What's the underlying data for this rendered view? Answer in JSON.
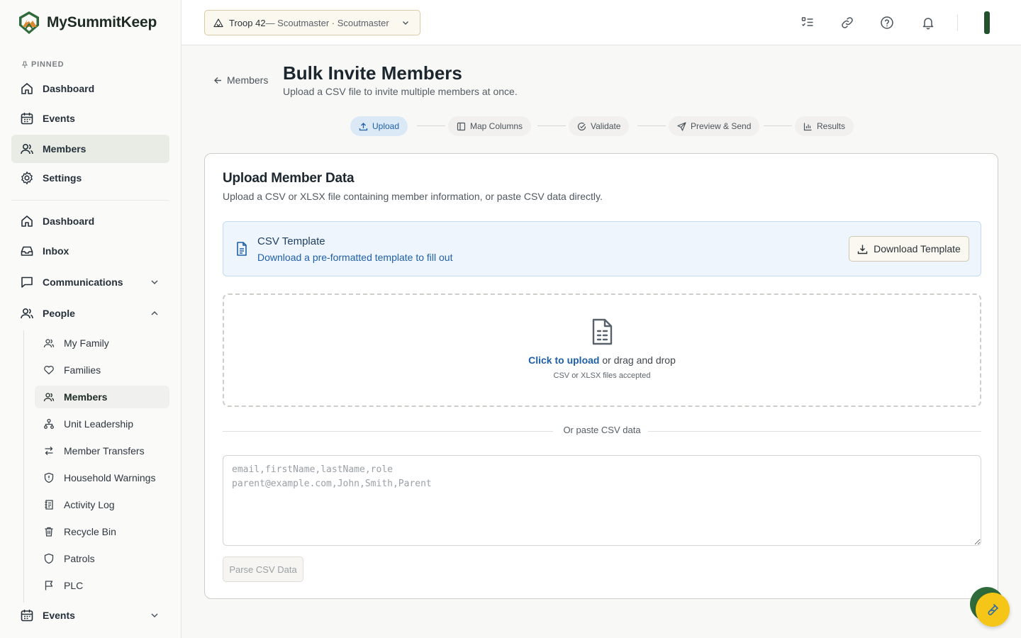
{
  "brand": {
    "name": "MySummitKeep"
  },
  "sidebar": {
    "pinned_label": "PINNED",
    "pinned": [
      {
        "label": "Dashboard",
        "icon": "home-icon"
      },
      {
        "label": "Events",
        "icon": "calendar-icon"
      },
      {
        "label": "Members",
        "icon": "users-icon",
        "active": true
      },
      {
        "label": "Settings",
        "icon": "gear-icon"
      }
    ],
    "main": [
      {
        "label": "Dashboard",
        "icon": "home-icon"
      },
      {
        "label": "Inbox",
        "icon": "inbox-icon"
      },
      {
        "label": "Communications",
        "icon": "message-icon",
        "expanded": false
      },
      {
        "label": "People",
        "icon": "users-icon",
        "expanded": true
      }
    ],
    "people_children": [
      {
        "label": "My Family",
        "icon": "users-icon"
      },
      {
        "label": "Families",
        "icon": "heart-icon"
      },
      {
        "label": "Members",
        "icon": "users-icon",
        "active": true
      },
      {
        "label": "Unit Leadership",
        "icon": "org-chart-icon"
      },
      {
        "label": "Member Transfers",
        "icon": "transfer-icon"
      },
      {
        "label": "Household Warnings",
        "icon": "shield-alert-icon"
      },
      {
        "label": "Activity Log",
        "icon": "log-icon"
      },
      {
        "label": "Recycle Bin",
        "icon": "trash-icon"
      },
      {
        "label": "Patrols",
        "icon": "shield-icon"
      },
      {
        "label": "PLC",
        "icon": "flag-icon"
      }
    ],
    "events_section": {
      "label": "Events",
      "icon": "calendar-icon",
      "expanded": false
    }
  },
  "header": {
    "troop": "Troop 42",
    "troop_role": " — Scoutmaster · Scoutmaster"
  },
  "page": {
    "back_label": "Members",
    "title": "Bulk Invite Members",
    "subtitle": "Upload a CSV file to invite multiple members at once."
  },
  "steps": [
    {
      "label": "Upload",
      "icon": "upload-icon",
      "active": true
    },
    {
      "label": "Map Columns",
      "icon": "columns-icon"
    },
    {
      "label": "Validate",
      "icon": "check-circle-icon"
    },
    {
      "label": "Preview & Send",
      "icon": "send-icon"
    },
    {
      "label": "Results",
      "icon": "bar-chart-icon"
    }
  ],
  "card": {
    "title": "Upload Member Data",
    "description": "Upload a CSV or XLSX file containing member information, or paste CSV data directly.",
    "template_title": "CSV Template",
    "template_link": "Download a pre-formatted template to fill out",
    "download_button": "Download Template",
    "drop_link": "Click to upload",
    "drop_text": " or drag and drop",
    "drop_hint": "CSV or XLSX files accepted",
    "or_text": "Or paste CSV data",
    "csv_placeholder": "email,firstName,lastName,role\nparent@example.com,John,Smith,Parent",
    "parse_button": "Parse CSV Data"
  },
  "colors": {
    "accent": "#1e5fa8",
    "brand_green": "#26512f",
    "active_nav": "#e8ece5",
    "fab": "#f5c518"
  }
}
